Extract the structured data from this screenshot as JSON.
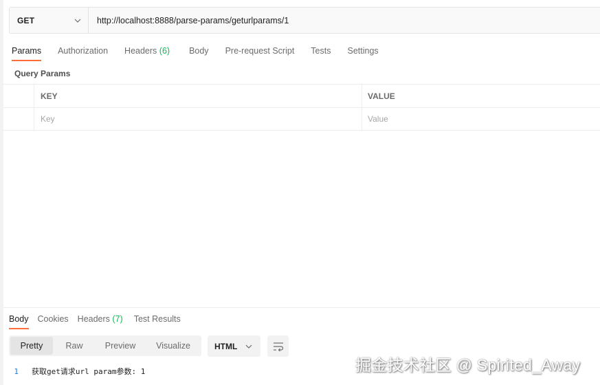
{
  "request": {
    "method": "GET",
    "url": "http://localhost:8888/parse-params/geturlparams/1"
  },
  "request_tabs": [
    {
      "label": "Params",
      "active": true
    },
    {
      "label": "Authorization"
    },
    {
      "label": "Headers",
      "count": "(6)"
    },
    {
      "label": "Body"
    },
    {
      "label": "Pre-request Script"
    },
    {
      "label": "Tests"
    },
    {
      "label": "Settings"
    }
  ],
  "query_params": {
    "title": "Query Params",
    "columns": {
      "key": "KEY",
      "value": "VALUE"
    },
    "placeholders": {
      "key": "Key",
      "value": "Value"
    }
  },
  "response_tabs": [
    {
      "label": "Body",
      "active": true
    },
    {
      "label": "Cookies"
    },
    {
      "label": "Headers",
      "count": "(7)"
    },
    {
      "label": "Test Results"
    }
  ],
  "response_view": {
    "modes": [
      "Pretty",
      "Raw",
      "Preview",
      "Visualize"
    ],
    "active_mode": "Pretty",
    "format": "HTML"
  },
  "response_body": {
    "line_number": "1",
    "text": "获取get请求url param参数: 1"
  },
  "watermark": "掘金技术社区 @ Spirited_Away",
  "colors": {
    "accent": "#ff6c37",
    "count": "#0cbb52",
    "line_number": "#1f7bd8"
  }
}
